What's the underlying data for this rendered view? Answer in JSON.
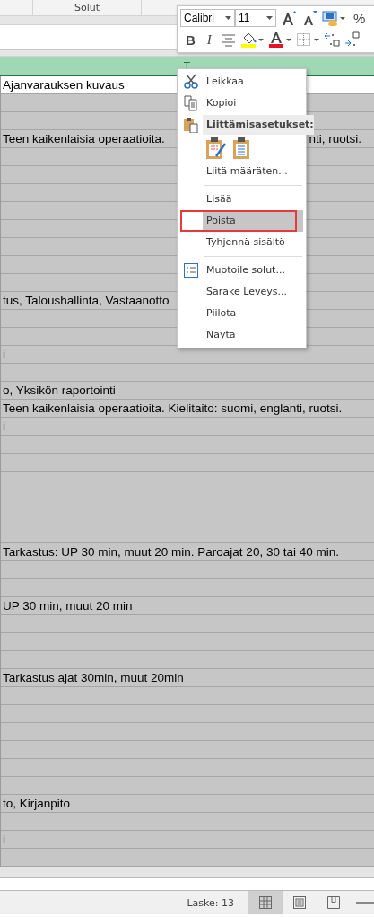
{
  "ribbon": {
    "group_label": "Solut"
  },
  "column_header": {
    "label": "T",
    "selected": true
  },
  "rows": [
    {
      "text": "Ajanvarauksen kuvaus",
      "selected": false
    },
    {
      "selected": true
    },
    {
      "selected": true
    },
    {
      "text": "Teen kaikenlaisia operaatioita.",
      "text_after_menu": "nti, ruotsi.",
      "selected": true
    },
    {
      "selected": true
    },
    {
      "selected": true
    },
    {
      "selected": true
    },
    {
      "selected": true
    },
    {
      "selected": true
    },
    {
      "selected": true
    },
    {
      "selected": true
    },
    {
      "selected": true
    },
    {
      "text": "tus, Taloushallinta, Vastaanotto",
      "selected": true
    },
    {
      "selected": true
    },
    {
      "selected": true
    },
    {
      "text": "i",
      "selected": true
    },
    {
      "selected": true
    },
    {
      "text": "o, Yksikön raportointi",
      "selected": true
    },
    {
      "text": "Teen kaikenlaisia operaatioita. Kielitaito: suomi, englanti, ruotsi.",
      "selected": true
    },
    {
      "text": "i",
      "selected": true
    },
    {
      "selected": true
    },
    {
      "selected": true
    },
    {
      "selected": true
    },
    {
      "selected": true
    },
    {
      "selected": true
    },
    {
      "selected": true
    },
    {
      "text": "Tarkastus: UP 30 min, muut 20 min. Paroajat 20, 30 tai 40 min.",
      "selected": true
    },
    {
      "selected": true
    },
    {
      "selected": true
    },
    {
      "text": "UP 30 min, muut 20 min",
      "selected": true
    },
    {
      "selected": true
    },
    {
      "selected": true
    },
    {
      "selected": true
    },
    {
      "text": "Tarkastus ajat 30min, muut 20min",
      "selected": true
    },
    {
      "selected": true
    },
    {
      "selected": true
    },
    {
      "selected": true
    },
    {
      "selected": true
    },
    {
      "selected": true
    },
    {
      "selected": true
    },
    {
      "text": "to, Kirjanpito",
      "selected": true
    },
    {
      "selected": true
    },
    {
      "text": "i",
      "selected": true
    },
    {
      "selected": true
    }
  ],
  "mini_toolbar": {
    "font": "Calibri",
    "size": "11",
    "percent": "%",
    "bold": "B",
    "italic": "I"
  },
  "context_menu": [
    {
      "kind": "item",
      "label": "Leikkaa",
      "highlighted": false
    },
    {
      "kind": "item",
      "label": "Kopioi",
      "highlighted": false
    },
    {
      "kind": "header",
      "label": "Liittämisasetukset:"
    },
    {
      "kind": "paste-options"
    },
    {
      "kind": "item",
      "label": "Liitä määräten...",
      "highlighted": false
    },
    {
      "kind": "separator"
    },
    {
      "kind": "item",
      "label": "Lisää",
      "highlighted": false
    },
    {
      "kind": "item",
      "label": "Poista",
      "highlighted": true,
      "annotated": true
    },
    {
      "kind": "item",
      "label": "Tyhjennä sisältö",
      "highlighted": false
    },
    {
      "kind": "separator"
    },
    {
      "kind": "item",
      "label": "Muotoile solut...",
      "highlighted": false
    },
    {
      "kind": "item",
      "label": "Sarake Leveys...",
      "highlighted": false
    },
    {
      "kind": "item",
      "label": "Piilota",
      "highlighted": false
    },
    {
      "kind": "item",
      "label": "Näytä",
      "highlighted": false
    }
  ],
  "status_bar": {
    "count": "Laske: 13",
    "views": [
      {
        "selected": true
      },
      {
        "selected": false
      },
      {
        "selected": false
      }
    ]
  }
}
